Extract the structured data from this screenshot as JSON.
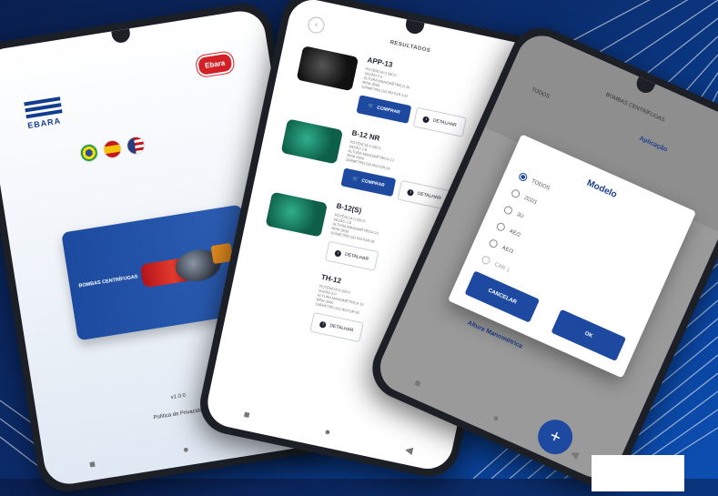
{
  "phone1": {
    "brand_left": "EBARA",
    "brand_right": "Ebara",
    "banner_title": "BOMBAS CENTRÍFUGAS",
    "version": "v1.0.0",
    "privacy_link": "Política de Privacidade"
  },
  "phone2": {
    "header": "RESULTADOS",
    "products": [
      {
        "name": "APP-13",
        "specs": [
          "POTÊNCIA 0.33CV",
          "VAZÃO 2.5",
          "ALTURA MANOMÉTRICA 16",
          "RPM 3500",
          "DIÂMETRO DO ROTOR 102"
        ],
        "buy": "COMPRAR",
        "detail": "DETALHAR"
      },
      {
        "name": "B-12 NR",
        "specs": [
          "POTÊNCIA 0.33CV",
          "VAZÃO 2.8",
          "ALTURA MANOMÉTRICA 12",
          "RPM 3500",
          "DIÂMETRO DO ROTOR 95"
        ],
        "buy": "COMPRAR",
        "detail": "DETALHAR"
      },
      {
        "name": "B-12(S)",
        "specs": [
          "POTÊNCIA 0.33CV",
          "VAZÃO 2.8",
          "ALTURA MANOMÉTRICA 12",
          "RPM 3500",
          "DIÂMETRO DO ROTOR 95"
        ],
        "detail": "DETALHAR"
      },
      {
        "name": "TH-12",
        "specs": [
          "POTÊNCIA 0.33CV",
          "VAZÃO 3.0",
          "ALTURA MANOMÉTRICA 10",
          "RPM 3500",
          "DIÂMETRO DO ROTOR 92"
        ],
        "detail": "DETALHAR"
      }
    ]
  },
  "phone3": {
    "title": "BOMBAS CENTRÍFUGAS",
    "filter_label": "TODOS",
    "application_label": "Aplicação",
    "altura_label": "Altura Manométrica",
    "dialog": {
      "title": "Modelo",
      "options": [
        "TODOS",
        "202/1",
        "3U",
        "AE/2",
        "AE/3",
        "CAR 1"
      ],
      "cancel": "CANCELAR",
      "ok": "OK"
    },
    "fab": "+"
  }
}
